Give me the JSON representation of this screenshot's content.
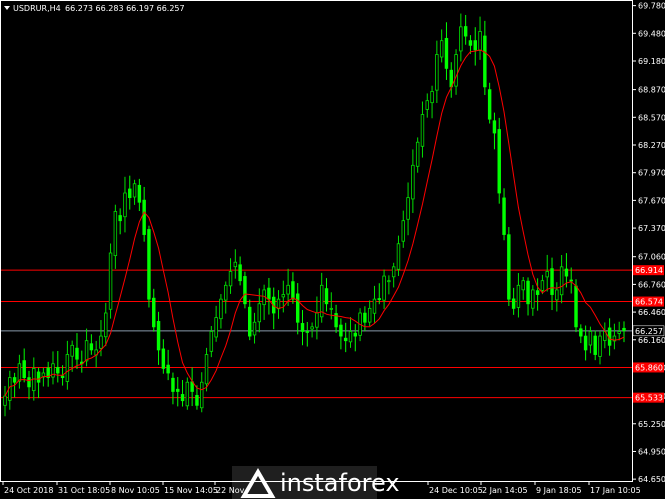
{
  "chart_data": {
    "type": "candlestick",
    "symbol": "USDRUR,H4",
    "ohlc_text": "66.273 66.283 66.197 66.257",
    "current_price": "66.257",
    "ylim": [
      64.63,
      69.83
    ],
    "y_ticks": [
      "69.780",
      "69.480",
      "69.180",
      "68.870",
      "68.570",
      "68.270",
      "67.970",
      "67.670",
      "67.370",
      "67.060",
      "66.760",
      "66.460",
      "66.160",
      "65.860",
      "65.550",
      "65.250",
      "64.950",
      "64.650"
    ],
    "x_labels": [
      "24 Oct 2018",
      "31 Oct 18:05",
      "8 Nov 10:05",
      "15 Nov 14:05",
      "22 Nov",
      "24 Dec 10:05",
      "2 Jan 14:05",
      "9 Jan 18:05",
      "17 Jan 10:05"
    ],
    "levels": [
      {
        "price": 66.914,
        "label": "66.914"
      },
      {
        "price": 66.574,
        "label": "66.574"
      },
      {
        "price": 65.86,
        "label": "65.860"
      },
      {
        "price": 65.533,
        "label": "65.533"
      }
    ],
    "close_series": [
      65.55,
      65.75,
      65.7,
      65.9,
      65.75,
      65.65,
      65.85,
      65.7,
      65.8,
      65.75,
      65.9,
      65.8,
      65.75,
      66.0,
      66.1,
      65.95,
      65.9,
      66.15,
      66.05,
      66.05,
      66.2,
      66.45,
      67.1,
      67.55,
      67.45,
      67.75,
      67.7,
      67.85,
      67.65,
      67.3,
      66.6,
      66.3,
      66.05,
      65.85,
      65.8,
      65.6,
      65.6,
      65.5,
      65.7,
      65.6,
      65.45,
      65.7,
      66.0,
      66.25,
      66.4,
      66.6,
      66.75,
      66.9,
      67.0,
      66.8,
      66.55,
      66.2,
      66.35,
      66.55,
      66.7,
      66.6,
      66.45,
      66.6,
      66.65,
      66.75,
      66.6,
      66.35,
      66.25,
      66.25,
      66.3,
      66.45,
      66.75,
      66.55,
      66.5,
      66.3,
      66.2,
      66.15,
      66.25,
      66.2,
      66.45,
      66.35,
      66.5,
      66.6,
      66.6,
      66.85,
      66.8,
      66.95,
      67.2,
      67.45,
      67.7,
      68.05,
      68.3,
      68.6,
      68.75,
      68.85,
      69.25,
      69.4,
      69.1,
      68.9,
      69.25,
      69.55,
      69.45,
      69.35,
      69.3,
      69.5,
      68.9,
      68.55,
      68.4,
      67.75,
      67.3,
      66.6,
      66.5,
      66.75,
      66.8,
      66.55,
      66.7,
      66.65,
      66.8,
      66.9,
      66.65,
      66.7,
      66.95,
      66.85,
      66.8,
      66.3,
      66.2,
      66.05,
      66.25,
      66.0,
      66.2,
      66.25,
      66.1,
      66.2,
      66.25,
      66.26
    ]
  },
  "watermark": {
    "text": "instaforex"
  },
  "colors": {
    "background": "#000000",
    "bull": "#00e000",
    "bear": "#00ff00",
    "ma": "#ff0000",
    "level": "#ff0000",
    "level_label_bg": "#ff0000",
    "grid": "#aaaaaa",
    "axis_text": "#ffffff",
    "price_line": "#8899aa"
  }
}
